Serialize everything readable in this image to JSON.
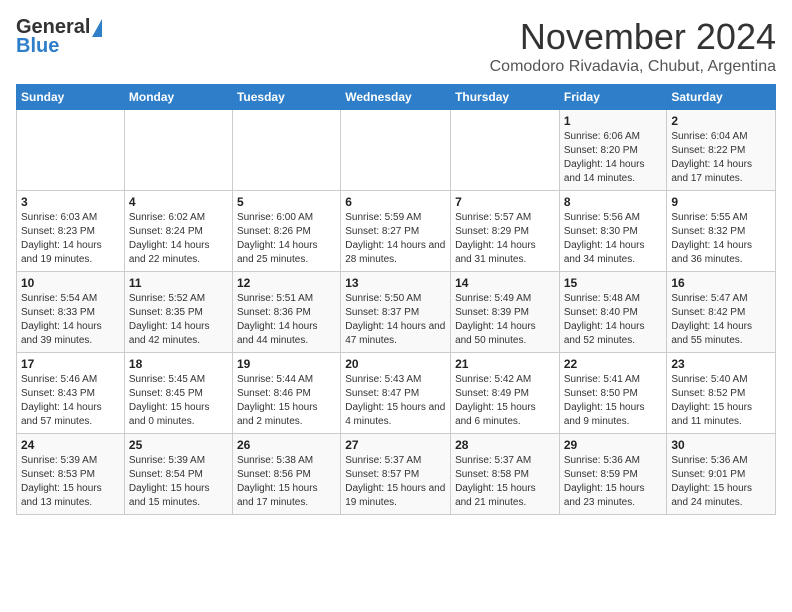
{
  "header": {
    "logo_general": "General",
    "logo_blue": "Blue",
    "month": "November 2024",
    "location": "Comodoro Rivadavia, Chubut, Argentina"
  },
  "weekdays": [
    "Sunday",
    "Monday",
    "Tuesday",
    "Wednesday",
    "Thursday",
    "Friday",
    "Saturday"
  ],
  "weeks": [
    [
      {
        "day": "",
        "info": ""
      },
      {
        "day": "",
        "info": ""
      },
      {
        "day": "",
        "info": ""
      },
      {
        "day": "",
        "info": ""
      },
      {
        "day": "",
        "info": ""
      },
      {
        "day": "1",
        "info": "Sunrise: 6:06 AM\nSunset: 8:20 PM\nDaylight: 14 hours and 14 minutes."
      },
      {
        "day": "2",
        "info": "Sunrise: 6:04 AM\nSunset: 8:22 PM\nDaylight: 14 hours and 17 minutes."
      }
    ],
    [
      {
        "day": "3",
        "info": "Sunrise: 6:03 AM\nSunset: 8:23 PM\nDaylight: 14 hours and 19 minutes."
      },
      {
        "day": "4",
        "info": "Sunrise: 6:02 AM\nSunset: 8:24 PM\nDaylight: 14 hours and 22 minutes."
      },
      {
        "day": "5",
        "info": "Sunrise: 6:00 AM\nSunset: 8:26 PM\nDaylight: 14 hours and 25 minutes."
      },
      {
        "day": "6",
        "info": "Sunrise: 5:59 AM\nSunset: 8:27 PM\nDaylight: 14 hours and 28 minutes."
      },
      {
        "day": "7",
        "info": "Sunrise: 5:57 AM\nSunset: 8:29 PM\nDaylight: 14 hours and 31 minutes."
      },
      {
        "day": "8",
        "info": "Sunrise: 5:56 AM\nSunset: 8:30 PM\nDaylight: 14 hours and 34 minutes."
      },
      {
        "day": "9",
        "info": "Sunrise: 5:55 AM\nSunset: 8:32 PM\nDaylight: 14 hours and 36 minutes."
      }
    ],
    [
      {
        "day": "10",
        "info": "Sunrise: 5:54 AM\nSunset: 8:33 PM\nDaylight: 14 hours and 39 minutes."
      },
      {
        "day": "11",
        "info": "Sunrise: 5:52 AM\nSunset: 8:35 PM\nDaylight: 14 hours and 42 minutes."
      },
      {
        "day": "12",
        "info": "Sunrise: 5:51 AM\nSunset: 8:36 PM\nDaylight: 14 hours and 44 minutes."
      },
      {
        "day": "13",
        "info": "Sunrise: 5:50 AM\nSunset: 8:37 PM\nDaylight: 14 hours and 47 minutes."
      },
      {
        "day": "14",
        "info": "Sunrise: 5:49 AM\nSunset: 8:39 PM\nDaylight: 14 hours and 50 minutes."
      },
      {
        "day": "15",
        "info": "Sunrise: 5:48 AM\nSunset: 8:40 PM\nDaylight: 14 hours and 52 minutes."
      },
      {
        "day": "16",
        "info": "Sunrise: 5:47 AM\nSunset: 8:42 PM\nDaylight: 14 hours and 55 minutes."
      }
    ],
    [
      {
        "day": "17",
        "info": "Sunrise: 5:46 AM\nSunset: 8:43 PM\nDaylight: 14 hours and 57 minutes."
      },
      {
        "day": "18",
        "info": "Sunrise: 5:45 AM\nSunset: 8:45 PM\nDaylight: 15 hours and 0 minutes."
      },
      {
        "day": "19",
        "info": "Sunrise: 5:44 AM\nSunset: 8:46 PM\nDaylight: 15 hours and 2 minutes."
      },
      {
        "day": "20",
        "info": "Sunrise: 5:43 AM\nSunset: 8:47 PM\nDaylight: 15 hours and 4 minutes."
      },
      {
        "day": "21",
        "info": "Sunrise: 5:42 AM\nSunset: 8:49 PM\nDaylight: 15 hours and 6 minutes."
      },
      {
        "day": "22",
        "info": "Sunrise: 5:41 AM\nSunset: 8:50 PM\nDaylight: 15 hours and 9 minutes."
      },
      {
        "day": "23",
        "info": "Sunrise: 5:40 AM\nSunset: 8:52 PM\nDaylight: 15 hours and 11 minutes."
      }
    ],
    [
      {
        "day": "24",
        "info": "Sunrise: 5:39 AM\nSunset: 8:53 PM\nDaylight: 15 hours and 13 minutes."
      },
      {
        "day": "25",
        "info": "Sunrise: 5:39 AM\nSunset: 8:54 PM\nDaylight: 15 hours and 15 minutes."
      },
      {
        "day": "26",
        "info": "Sunrise: 5:38 AM\nSunset: 8:56 PM\nDaylight: 15 hours and 17 minutes."
      },
      {
        "day": "27",
        "info": "Sunrise: 5:37 AM\nSunset: 8:57 PM\nDaylight: 15 hours and 19 minutes."
      },
      {
        "day": "28",
        "info": "Sunrise: 5:37 AM\nSunset: 8:58 PM\nDaylight: 15 hours and 21 minutes."
      },
      {
        "day": "29",
        "info": "Sunrise: 5:36 AM\nSunset: 8:59 PM\nDaylight: 15 hours and 23 minutes."
      },
      {
        "day": "30",
        "info": "Sunrise: 5:36 AM\nSunset: 9:01 PM\nDaylight: 15 hours and 24 minutes."
      }
    ]
  ]
}
